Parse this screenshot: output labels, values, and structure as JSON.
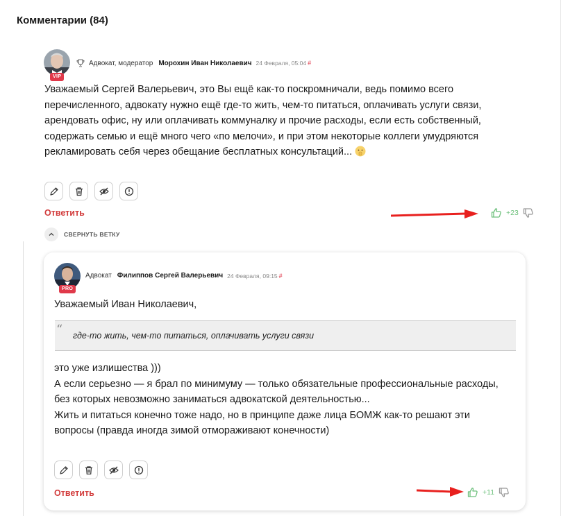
{
  "section": {
    "title": "Комментарии (84)"
  },
  "comments": [
    {
      "badge": "VIP",
      "role": "Адвокат, модератор",
      "author": "Морохин Иван Николаевич",
      "date": "24 Февраля, 05:04",
      "hash": "#",
      "lines": [
        "Уважаемый Сергей Валерьевич, это Вы ещё как-то поскромничали, ведь помимо всего",
        "перечисленного, адвокату нужно ещё где-то жить, чем-то питаться, оплачивать услуги связи,",
        "арендовать офис,  ну или оплачивать коммуналку и прочие расходы, если есть собственный,",
        "содержать семью и ещё много чего «по мелочи», и при этом некоторые коллеги умудряются",
        "рекламировать себя через обещание бесплатных консультаций..."
      ],
      "reply_label": "Ответить",
      "votes": "+23"
    },
    {
      "badge": "PRO",
      "role": "Адвокат",
      "author": "Филиппов Сергей Валерьевич",
      "date": "24 Февраля, 09:15",
      "hash": "#",
      "greeting": "Уважаемый Иван Николаевич,",
      "quote": "где-то жить, чем-то питаться, оплачивать услуги связи",
      "lines": [
        "это уже излишества )))",
        "А если серьезно — я брал по минимуму — только обязательные профессиональные расходы,",
        "без которых невозможно заниматься адвокатской деятельностью...",
        "Жить и питаться конечно тоже надо, но в принципе даже лица БОМЖ как-то решают эти",
        "вопросы (правда иногда зимой отмораживают конечности)"
      ],
      "reply_label": "Ответить",
      "votes": "+11"
    }
  ],
  "thread": {
    "collapse_label": "СВЕРНУТЬ ВЕТКУ"
  },
  "colors": {
    "accent_red": "#d23c3c",
    "badge_red": "#e0394a",
    "like_green": "#6bbf7a",
    "arrow_red": "#e8201e"
  },
  "icons": [
    "pencil-icon",
    "trash-icon",
    "eye-crossed-icon",
    "warning-icon",
    "thumb-up-icon",
    "thumb-down-icon",
    "trophy-icon",
    "chevron-up-icon"
  ]
}
